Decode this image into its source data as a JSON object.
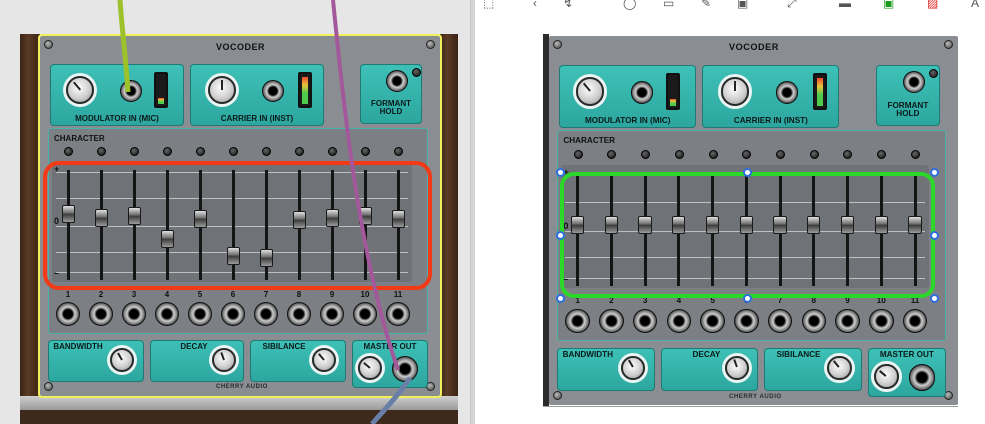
{
  "module": {
    "title": "VOCODER",
    "modulator_label": "MODULATOR IN (MIC)",
    "carrier_label": "CARRIER IN (INST)",
    "formant_label": "FORMANT HOLD",
    "character_label": "CHARACTER",
    "scale_plus": "+",
    "scale_zero": "0",
    "scale_minus": "–",
    "bandwidth_label": "BANDWIDTH",
    "decay_label": "DECAY",
    "sibilance_label": "SIBILANCE",
    "master_out_label": "MASTER OUT",
    "brand": "CHERRY AUDIO",
    "band_numbers": [
      "1",
      "2",
      "3",
      "4",
      "5",
      "6",
      "7",
      "8",
      "9",
      "10",
      "11"
    ]
  },
  "left_faders": [
    0.62,
    0.58,
    0.6,
    0.35,
    0.56,
    0.16,
    0.14,
    0.55,
    0.58,
    0.6,
    0.57
  ],
  "right_faders": [
    0.55,
    0.55,
    0.55,
    0.55,
    0.55,
    0.55,
    0.55,
    0.55,
    0.55,
    0.55,
    0.55
  ],
  "colors": {
    "panel_teal": "#3ec1b8",
    "selection_yellow": "#f2f05a",
    "annotation_red": "#f23a16",
    "annotation_green": "#2bd829",
    "handle_blue": "#2d6fe0",
    "cable_green": "#9cc12a",
    "cable_purple": "#a4589c",
    "cable_blue": "#6a7fa8"
  }
}
